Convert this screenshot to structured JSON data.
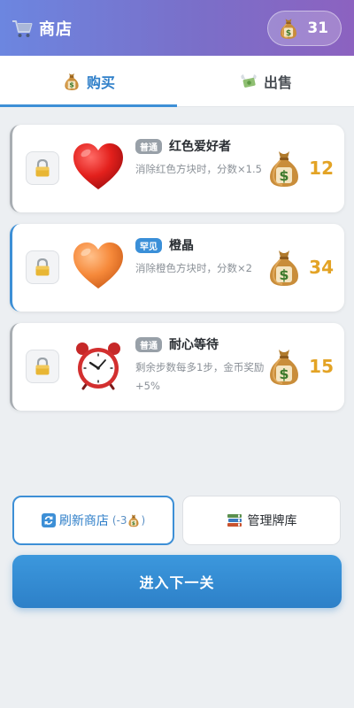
{
  "header": {
    "title": "商店",
    "cart_icon": "cart-icon",
    "coins": "31",
    "coin_icon": "money-bag-icon"
  },
  "tabs": [
    {
      "label": "购买",
      "icon": "money-bag-icon",
      "active": true
    },
    {
      "label": "出售",
      "icon": "money-wings-icon",
      "active": false
    }
  ],
  "items": [
    {
      "rarity": "普通",
      "name": "红色爱好者",
      "desc": "消除红色方块时，分数×1.5",
      "price": "12",
      "art": "red-heart-icon",
      "locked": true
    },
    {
      "rarity": "罕见",
      "name": "橙晶",
      "desc": "消除橙色方块时，分数×2",
      "price": "34",
      "art": "orange-heart-icon",
      "locked": true
    },
    {
      "rarity": "普通",
      "name": "耐心等待",
      "desc": "剩余步数每多1步，金币奖励+5%",
      "price": "15",
      "art": "alarm-clock-icon",
      "locked": true
    }
  ],
  "buttons": {
    "refresh_label": "刷新商店",
    "refresh_cost_prefix": "(-3",
    "refresh_cost_suffix": ")",
    "deck_label": "管理牌库",
    "next_label": "进入下一关"
  },
  "colors": {
    "accent": "#3d8fd6",
    "price": "#e3a325",
    "header_start": "#6c86e0",
    "header_end": "#8c62c0"
  }
}
